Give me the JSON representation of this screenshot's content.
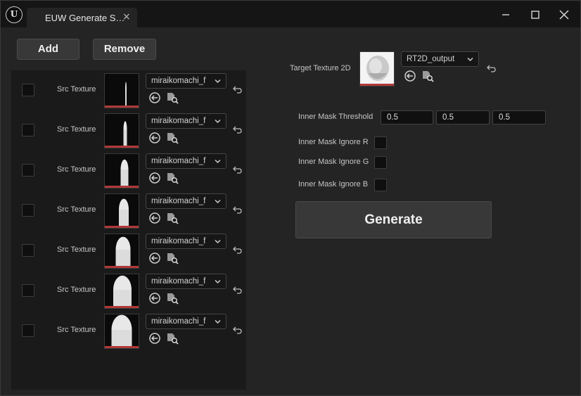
{
  "window": {
    "tab_title": "EUW Generate S…",
    "tab_close": "×"
  },
  "toolbar": {
    "add_label": "Add",
    "remove_label": "Remove"
  },
  "src_list": {
    "items": [
      {
        "label": "Src Texture",
        "asset": "miraikomachi_f",
        "checked": false,
        "fill": 0.05
      },
      {
        "label": "Src Texture",
        "asset": "miraikomachi_f",
        "checked": false,
        "fill": 0.15
      },
      {
        "label": "Src Texture",
        "asset": "miraikomachi_f",
        "checked": false,
        "fill": 0.35
      },
      {
        "label": "Src Texture",
        "asset": "miraikomachi_f",
        "checked": false,
        "fill": 0.45
      },
      {
        "label": "Src Texture",
        "asset": "miraikomachi_f",
        "checked": false,
        "fill": 0.7
      },
      {
        "label": "Src Texture",
        "asset": "miraikomachi_f",
        "checked": false,
        "fill": 0.85
      },
      {
        "label": "Src Texture",
        "asset": "miraikomachi_f",
        "checked": false,
        "fill": 0.95
      }
    ]
  },
  "target": {
    "label": "Target Texture 2D",
    "asset": "RT2D_output"
  },
  "threshold": {
    "label": "Inner Mask Threshold",
    "values": [
      "0.5",
      "0.5",
      "0.5"
    ]
  },
  "ignore": {
    "r_label": "Inner Mask Ignore R",
    "g_label": "Inner Mask Ignore G",
    "b_label": "Inner Mask Ignore B"
  },
  "generate_label": "Generate",
  "colors": {
    "accent_bar": "#b13838",
    "panel_bg": "#242424",
    "list_bg": "#1a1a1a"
  }
}
